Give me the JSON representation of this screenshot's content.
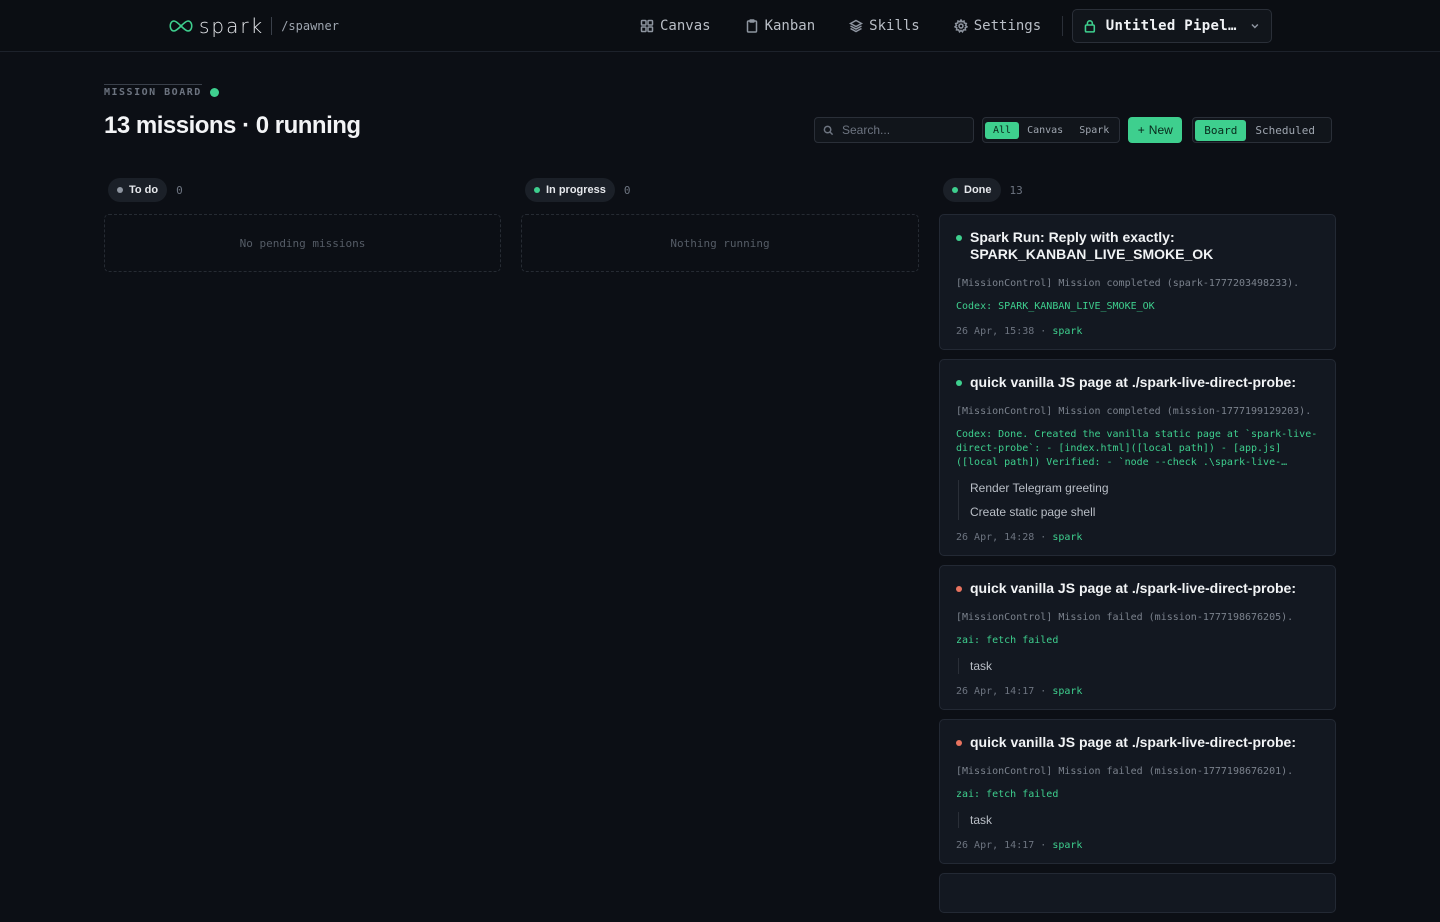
{
  "brand": {
    "name": "spark",
    "sub": "/spawner"
  },
  "nav": [
    {
      "label": "Canvas",
      "icon": "grid-icon"
    },
    {
      "label": "Kanban",
      "icon": "clipboard-icon"
    },
    {
      "label": "Skills",
      "icon": "layers-icon"
    },
    {
      "label": "Settings",
      "icon": "gear-icon"
    }
  ],
  "pipeline": {
    "label": "Untitled Pipel…"
  },
  "header": {
    "eyebrow": "MISSION BOARD",
    "title": "13 missions · 0 running"
  },
  "search": {
    "placeholder": "Search..."
  },
  "filters": [
    "All",
    "Canvas",
    "Spark"
  ],
  "new_label": "New",
  "views": [
    "Board",
    "Scheduled"
  ],
  "columns": [
    {
      "label": "To do",
      "count": "0",
      "empty": "No pending missions"
    },
    {
      "label": "In progress",
      "count": "0",
      "empty": "Nothing running"
    },
    {
      "label": "Done",
      "count": "13"
    }
  ],
  "colors": {
    "accent": "#3ecf8e",
    "failed": "#e8735f",
    "neutral": "#8e95a0"
  },
  "cards": [
    {
      "status": "completed",
      "title": "Spark Run: Reply with exactly: SPARK_KANBAN_LIVE_SMOKE_OK",
      "meta": "[MissionControl] Mission completed (spark-1777203498233).",
      "output": "Codex: SPARK_KANBAN_LIVE_SMOKE_OK",
      "time": "26 Apr, 15:38",
      "agent": "spark"
    },
    {
      "status": "completed",
      "title": "quick vanilla JS page at ./spark-live-direct-probe:",
      "meta": "[MissionControl] Mission completed (mission-1777199129203).",
      "output": "Codex: Done. Created the vanilla static page at `spark-live-direct-probe`: - [index.html]([local path]) - [app.js]([local path]) Verified: - `node --check .\\spark-live-direct-probe\\app.js`",
      "subtasks": [
        "Render Telegram greeting",
        "Create static page shell"
      ],
      "time": "26 Apr, 14:28",
      "agent": "spark"
    },
    {
      "status": "failed",
      "title": "quick vanilla JS page at ./spark-live-direct-probe:",
      "meta": "[MissionControl] Mission failed (mission-1777198676205).",
      "output": "zai: fetch failed",
      "subtasks": [
        "task"
      ],
      "time": "26 Apr, 14:17",
      "agent": "spark"
    },
    {
      "status": "failed",
      "title": "quick vanilla JS page at ./spark-live-direct-probe:",
      "meta": "[MissionControl] Mission failed (mission-1777198676201).",
      "output": "zai: fetch failed",
      "subtasks": [
        "task"
      ],
      "time": "26 Apr, 14:17",
      "agent": "spark"
    }
  ]
}
